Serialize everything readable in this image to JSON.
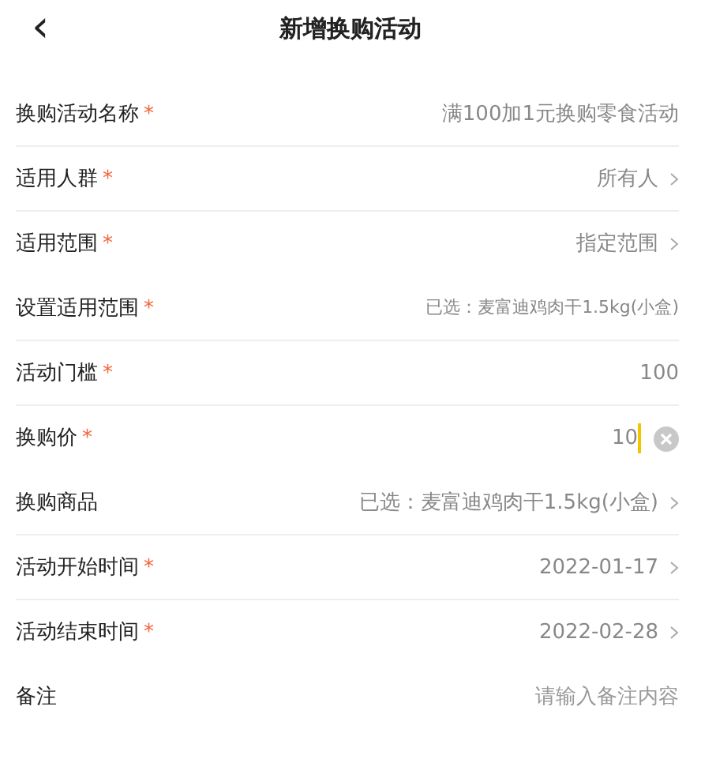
{
  "header": {
    "back": "‹",
    "title": "新增换购活动"
  },
  "fields": [
    {
      "label": "换购活动名称",
      "required": "*",
      "kind": "text",
      "value": "满100加1元换购零食活动",
      "divider": true
    },
    {
      "label": "适用人群",
      "required": "*",
      "kind": "select",
      "value": "所有人",
      "divider": true
    },
    {
      "label": "适用范围",
      "required": "*",
      "kind": "select",
      "value": "指定范围",
      "divider": false
    },
    {
      "label": "设置适用范围",
      "required": "*",
      "kind": "summary",
      "value": "已选：麦富迪鸡肉干1.5kg(小盒)",
      "divider": true
    },
    {
      "label": "活动门槛",
      "required": "*",
      "kind": "text",
      "value": "100",
      "divider": true
    },
    {
      "label": "换购价",
      "required": "*",
      "kind": "input",
      "value": "10",
      "divider": false
    },
    {
      "label": "换购商品",
      "kind": "select",
      "value": "已选：麦富迪鸡肉干1.5kg(小盒)",
      "divider": true
    },
    {
      "label": "活动开始时间",
      "required": "*",
      "kind": "select",
      "value": "2022-01-17",
      "divider": true
    },
    {
      "label": "活动结束时间",
      "required": "*",
      "kind": "select",
      "value": "2022-02-28",
      "divider": false
    },
    {
      "label": "备注",
      "kind": "note",
      "placeholder": "请输入备注内容",
      "divider": false
    }
  ]
}
